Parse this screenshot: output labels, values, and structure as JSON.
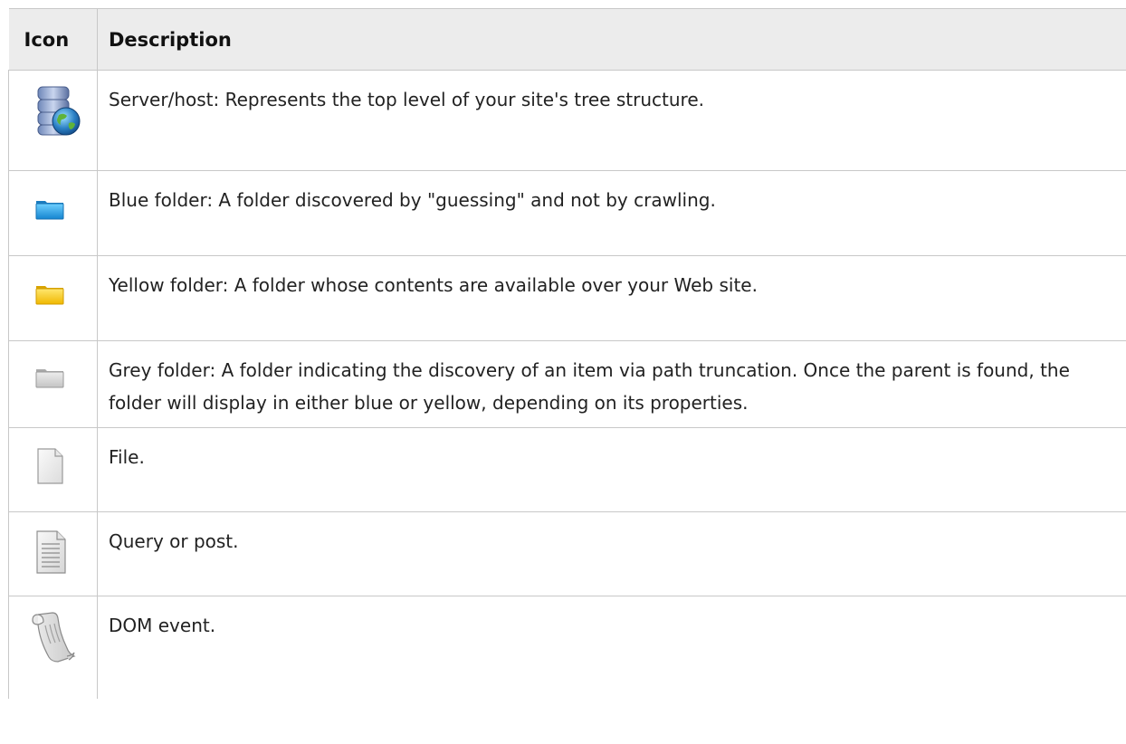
{
  "table": {
    "headers": {
      "icon": "Icon",
      "description": "Description"
    },
    "rows": [
      {
        "icon": "server-globe-icon",
        "description": "Server/host: Represents the top level of your site's tree structure."
      },
      {
        "icon": "blue-folder-icon",
        "description": "Blue folder: A folder discovered by \"guessing\" and not by crawling."
      },
      {
        "icon": "yellow-folder-icon",
        "description": "Yellow folder: A folder whose contents are available over your Web site."
      },
      {
        "icon": "grey-folder-icon",
        "description": "Grey folder: A folder indicating the discovery of an item via path truncation. Once the parent is found, the folder will display in either blue or yellow, depending on its properties."
      },
      {
        "icon": "file-icon",
        "description": "File."
      },
      {
        "icon": "query-document-icon",
        "description": "Query or post."
      },
      {
        "icon": "scroll-icon",
        "description": "DOM event."
      }
    ]
  },
  "colors": {
    "header_bg": "#ececec",
    "border": "#c8c8c8",
    "blue_folder": "#1e9be0",
    "yellow_folder": "#f5c400",
    "grey_folder": "#c8c8c8"
  }
}
